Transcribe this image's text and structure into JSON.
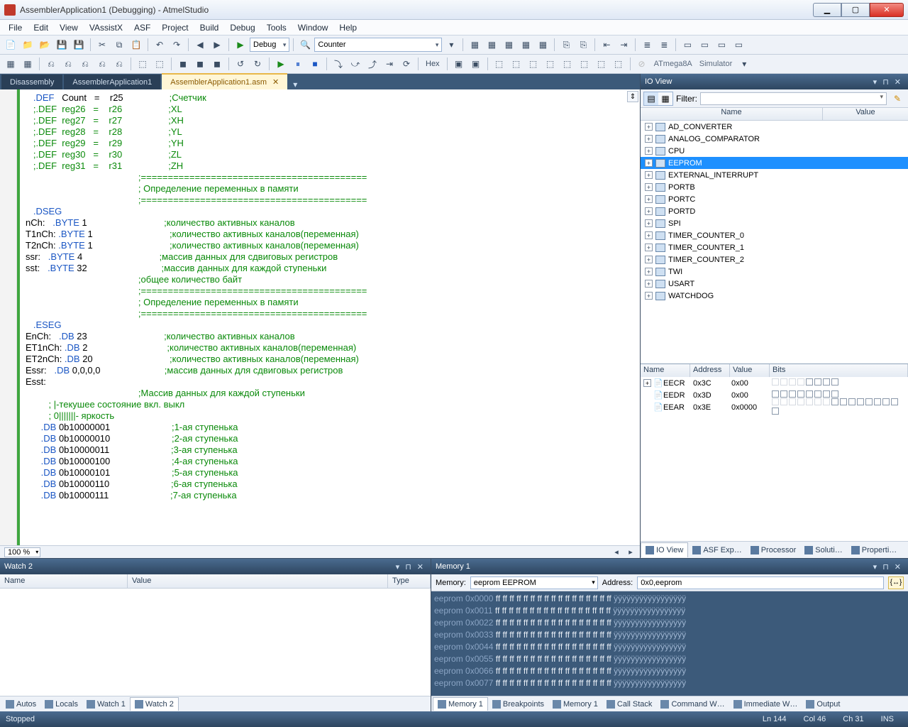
{
  "window": {
    "title": "AssemblerApplication1 (Debugging) - AtmelStudio",
    "min": "▁",
    "max": "▢",
    "close": "✕"
  },
  "menu": [
    "File",
    "Edit",
    "View",
    "VAssistX",
    "ASF",
    "Project",
    "Build",
    "Debug",
    "Tools",
    "Window",
    "Help"
  ],
  "toolbar1": {
    "config": "Debug",
    "target": "Counter",
    "device": "ATmega8A",
    "tool": "Simulator"
  },
  "toolbar2": {
    "hex": "Hex"
  },
  "tabs": [
    {
      "label": "Disassembly",
      "active": false
    },
    {
      "label": "AssemblerApplication1",
      "active": false
    },
    {
      "label": "AssemblerApplication1.asm",
      "active": true
    }
  ],
  "code_lines": [
    {
      "a": "   .DEF   Count   =    r25",
      "c": ";Счетчик"
    },
    {
      "a": "   ;.DEF  reg26   =    r26",
      "c": ";XL"
    },
    {
      "a": "   ;.DEF  reg27   =    r27",
      "c": ";XH"
    },
    {
      "a": "   ;.DEF  reg28   =    r28",
      "c": ";YL"
    },
    {
      "a": "   ;.DEF  reg29   =    r29",
      "c": ";YH"
    },
    {
      "a": "   ;.DEF  reg30   =    r30",
      "c": ";ZL"
    },
    {
      "a": "   ;.DEF  reg31   =    r31",
      "c": ";ZH"
    },
    {
      "a": "",
      "c": ""
    },
    {
      "a": "",
      "c": ";=========================================="
    },
    {
      "a": "",
      "c": "; Определение переменных в памяти"
    },
    {
      "a": "",
      "c": ";=========================================="
    },
    {
      "a": "",
      "c": ""
    },
    {
      "a": "   .DSEG",
      "c": ""
    },
    {
      "a": "",
      "c": ""
    },
    {
      "a": "nCh:   .BYTE 1",
      "c": ";количество активных каналов"
    },
    {
      "a": "T1nCh: .BYTE 1",
      "c": ";количество активных каналов(переменная)"
    },
    {
      "a": "T2nCh: .BYTE 1",
      "c": ";количество активных каналов(переменная)"
    },
    {
      "a": "ssr:   .BYTE 4",
      "c": ";массив данных для сдвиговых регистров"
    },
    {
      "a": "sst:   .BYTE 32",
      "c": ";массив данных для каждой ступеньки"
    },
    {
      "a": "",
      "c": ""
    },
    {
      "a": "",
      "c": ";общее количество байт"
    },
    {
      "a": "",
      "c": ";=========================================="
    },
    {
      "a": "",
      "c": "; Определение переменных в памяти"
    },
    {
      "a": "",
      "c": ";=========================================="
    },
    {
      "a": "",
      "c": ""
    },
    {
      "a": "   .ESEG",
      "c": ""
    },
    {
      "a": "EnCh:   .DB 23",
      "c": ";количество активных каналов"
    },
    {
      "a": "ET1nCh: .DB 2",
      "c": ";количество активных каналов(переменная)"
    },
    {
      "a": "ET2nCh: .DB 20",
      "c": ";количество активных каналов(переменная)"
    },
    {
      "a": "Essr:   .DB 0,0,0,0",
      "c": ";массив данных для сдвиговых регистров"
    },
    {
      "a": "Esst:",
      "c": ""
    },
    {
      "a": "",
      "c": ";Массив данных для каждой ступеньки"
    },
    {
      "a": "         ; |-текушее состояние вкл. выкл",
      "c": ""
    },
    {
      "a": "         ; 0|||||||- яркость",
      "c": ""
    },
    {
      "a": "      .DB 0b10000001",
      "c": ";1-ая ступенька"
    },
    {
      "a": "      .DB 0b10000010",
      "c": ";2-ая ступенька"
    },
    {
      "a": "      .DB 0b10000011",
      "c": ";3-ая ступенька"
    },
    {
      "a": "      .DB 0b10000100",
      "c": ";4-ая ступенька"
    },
    {
      "a": "      .DB 0b10000101",
      "c": ";5-ая ступенька"
    },
    {
      "a": "      .DB 0b10000110",
      "c": ";6-ая ступенька"
    },
    {
      "a": "      .DB 0b10000111",
      "c": ";7-ая ступенька"
    }
  ],
  "zoom": "100 %",
  "ioview": {
    "title": "IO View",
    "filter_label": "Filter:",
    "columns": [
      "Name",
      "Value"
    ],
    "nodes": [
      {
        "name": "AD_CONVERTER",
        "sel": false
      },
      {
        "name": "ANALOG_COMPARATOR",
        "sel": false
      },
      {
        "name": "CPU",
        "sel": false
      },
      {
        "name": "EEPROM",
        "sel": true
      },
      {
        "name": "EXTERNAL_INTERRUPT",
        "sel": false
      },
      {
        "name": "PORTB",
        "sel": false
      },
      {
        "name": "PORTC",
        "sel": false
      },
      {
        "name": "PORTD",
        "sel": false
      },
      {
        "name": "SPI",
        "sel": false
      },
      {
        "name": "TIMER_COUNTER_0",
        "sel": false
      },
      {
        "name": "TIMER_COUNTER_1",
        "sel": false
      },
      {
        "name": "TIMER_COUNTER_2",
        "sel": false
      },
      {
        "name": "TWI",
        "sel": false
      },
      {
        "name": "USART",
        "sel": false
      },
      {
        "name": "WATCHDOG",
        "sel": false
      }
    ],
    "reg_cols": [
      "Name",
      "Address",
      "Value",
      "Bits"
    ],
    "regs": [
      {
        "name": "EECR",
        "addr": "0x3C",
        "val": "0x00",
        "bits": 8,
        "dim": 4
      },
      {
        "name": "EEDR",
        "addr": "0x3D",
        "val": "0x00",
        "bits": 8,
        "dim": 0
      },
      {
        "name": "EEAR",
        "addr": "0x3E",
        "val": "0x0000",
        "bits": 16,
        "dim": 7
      }
    ]
  },
  "right_tabs": [
    {
      "label": "IO View",
      "on": true
    },
    {
      "label": "ASF Exp…",
      "on": false
    },
    {
      "label": "Processor",
      "on": false
    },
    {
      "label": "Soluti…",
      "on": false
    },
    {
      "label": "Properti…",
      "on": false
    }
  ],
  "watch": {
    "title": "Watch 2",
    "cols": [
      "Name",
      "Value",
      "Type"
    ]
  },
  "memory": {
    "title": "Memory 1",
    "memory_label": "Memory:",
    "memory_sel": "eeprom EEPROM",
    "address_label": "Address:",
    "address_val": "0x0,eeprom",
    "rows": [
      {
        "a": "eeprom 0x0000"
      },
      {
        "a": "eeprom 0x0011"
      },
      {
        "a": "eeprom 0x0022"
      },
      {
        "a": "eeprom 0x0033"
      },
      {
        "a": "eeprom 0x0044"
      },
      {
        "a": "eeprom 0x0055"
      },
      {
        "a": "eeprom 0x0066"
      },
      {
        "a": "eeprom 0x0077"
      }
    ],
    "hex": "ff  ff ff ff  ff ff ff  ff ff ff  ff ff ff  ff ff ff  ff",
    "asc": "ÿÿÿÿÿÿÿÿÿÿÿÿÿÿÿÿÿ"
  },
  "left_bottom_tabs": [
    {
      "label": "Autos"
    },
    {
      "label": "Locals"
    },
    {
      "label": "Watch 1"
    },
    {
      "label": "Watch 2",
      "on": true
    }
  ],
  "right_bottom_tabs": [
    {
      "label": "Memory 1",
      "on": true
    },
    {
      "label": "Breakpoints"
    },
    {
      "label": "Memory 1"
    },
    {
      "label": "Call Stack"
    },
    {
      "label": "Command W…"
    },
    {
      "label": "Immediate W…"
    },
    {
      "label": "Output"
    }
  ],
  "status": {
    "state": "Stopped",
    "ln": "Ln 144",
    "col": "Col 46",
    "ch": "Ch 31",
    "ins": "INS"
  }
}
